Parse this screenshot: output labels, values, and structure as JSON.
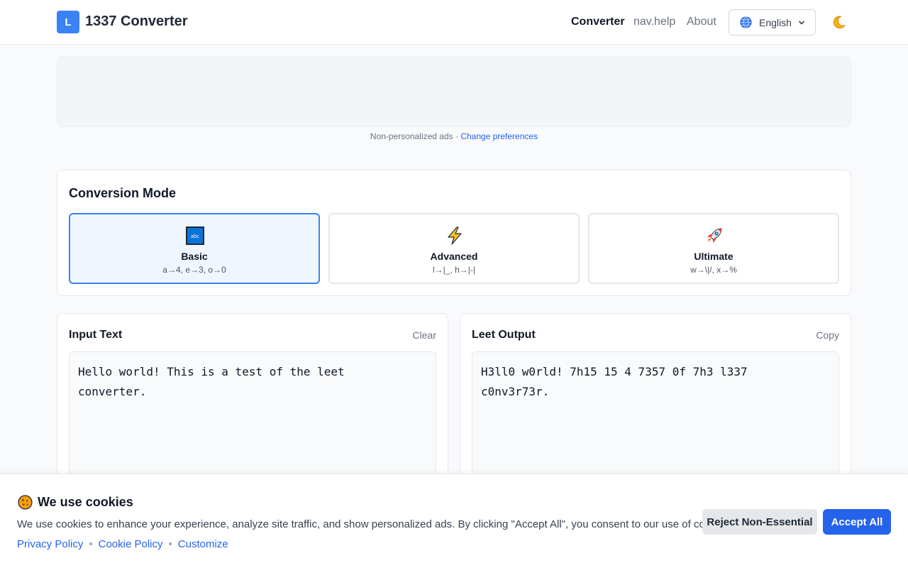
{
  "header": {
    "logo_letter": "L",
    "title": "1337 Converter",
    "nav": [
      {
        "label": "Converter"
      },
      {
        "label": "nav.help"
      },
      {
        "label": "About"
      }
    ],
    "language": {
      "selected": "English",
      "icon": "globe-icon"
    },
    "theme_toggle_icon": "moon-icon"
  },
  "ad": {
    "note": "Non-personalized ads · ",
    "change_link": "Change preferences"
  },
  "mode": {
    "title": "Conversion Mode",
    "options": [
      {
        "name": "Basic",
        "desc": "a→4, e→3, o→0",
        "icon": "abc-icon",
        "selected": true
      },
      {
        "name": "Advanced",
        "desc": "l→|_, h→|-|",
        "icon": "lightning-icon",
        "selected": false
      },
      {
        "name": "Ultimate",
        "desc": "w→\\|/, x→%",
        "icon": "rocket-icon",
        "selected": false
      }
    ]
  },
  "input": {
    "title": "Input Text",
    "action": "Clear",
    "value": "Hello world! This is a test of the leet\nconverter."
  },
  "output": {
    "title": "Leet Output",
    "action": "Copy",
    "value": "H3ll0 w0rld! 7h15 15 4 7357 0f 7h3 l337\nc0nv3r73r."
  },
  "cookies": {
    "title": "We use cookies",
    "text": "We use cookies to enhance your experience, analyze site traffic, and show personalized ads. By clicking \"Accept All\", you consent to our use of cookies.",
    "links": [
      "Privacy Policy",
      "Cookie Policy",
      "Customize"
    ],
    "reject_label": "Reject Non-Essential",
    "accept_label": "Accept All"
  },
  "colors": {
    "accent": "#2563eb",
    "logo": "#3b82f6",
    "selected_bg": "#eff6ff"
  }
}
